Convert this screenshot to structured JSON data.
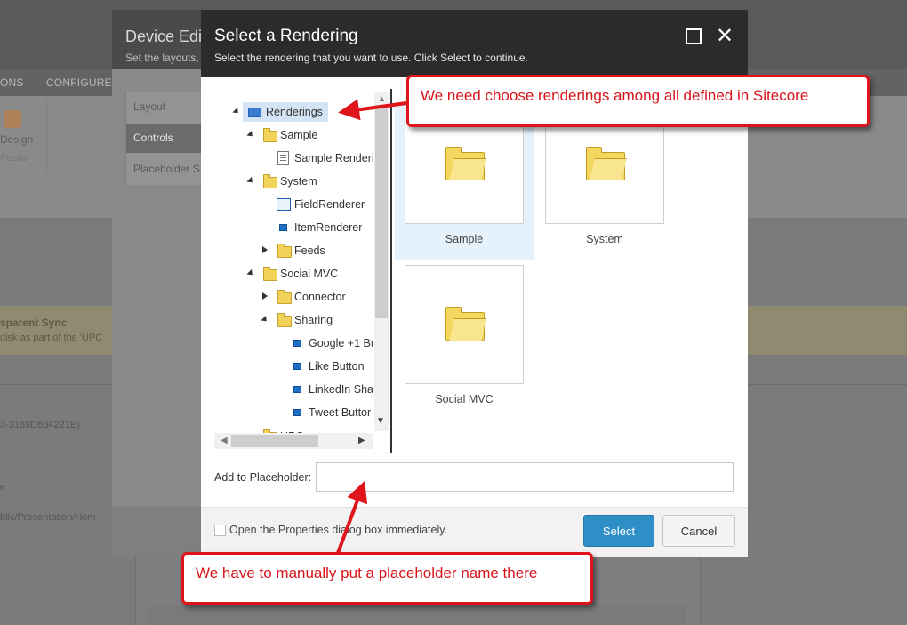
{
  "background": {
    "ribbon_tabs": [
      "ONS",
      "CONFIGURE"
    ],
    "ribbon_design_label": "Design",
    "ribbon_feeds_label": "Feeds",
    "warning_title": "sparent Sync",
    "warning_text": "disk as part of the 'UPC",
    "item_guid": "3-3189D684221E}",
    "field_e": "e",
    "item_path": "blic/Presentation/Hom"
  },
  "device_editor": {
    "title": "Device Edi",
    "subtitle": "Set the layouts,",
    "nav": [
      "Layout",
      "Controls",
      "Placeholder S"
    ],
    "selected_nav": "Controls"
  },
  "dialog": {
    "title": "Select a Rendering",
    "subtitle": "Select the rendering that you want to use. Click Select to continue.",
    "tree": [
      {
        "label": "Renderings",
        "icon": "renderings-root-icon",
        "expander": "down",
        "selected": true
      },
      {
        "label": "Sample",
        "icon": "folder-icon",
        "expander": "down"
      },
      {
        "label": "Sample Renderi",
        "icon": "rendering-document-icon",
        "expander": ""
      },
      {
        "label": "System",
        "icon": "folder-icon",
        "expander": "down"
      },
      {
        "label": "FieldRenderer",
        "icon": "field-renderer-icon",
        "expander": ""
      },
      {
        "label": "ItemRenderer",
        "icon": "rendering-icon",
        "expander": ""
      },
      {
        "label": "Feeds",
        "icon": "folder-icon",
        "expander": "right"
      },
      {
        "label": "Social MVC",
        "icon": "folder-icon",
        "expander": "down"
      },
      {
        "label": "Connector",
        "icon": "folder-icon",
        "expander": "right"
      },
      {
        "label": "Sharing",
        "icon": "folder-icon",
        "expander": "down"
      },
      {
        "label": "Google +1 Bu",
        "icon": "rendering-icon",
        "expander": ""
      },
      {
        "label": "Like Button",
        "icon": "rendering-icon",
        "expander": ""
      },
      {
        "label": "LinkedIn Sha",
        "icon": "rendering-icon",
        "expander": ""
      },
      {
        "label": "Tweet Buttor",
        "icon": "rendering-icon",
        "expander": ""
      },
      {
        "label": "UPC",
        "icon": "folder-icon",
        "expander": ""
      }
    ],
    "tiles": [
      {
        "label": "Sample",
        "icon": "large-folder-icon",
        "highlighted": true
      },
      {
        "label": "System",
        "icon": "large-folder-icon",
        "highlighted": false
      },
      {
        "label": "Social MVC",
        "icon": "large-folder-icon",
        "highlighted": false
      }
    ],
    "placeholder_label": "Add to Placeholder:",
    "placeholder_value": "",
    "open_properties_label": "Open the Properties dialog box immediately.",
    "open_properties_checked": false,
    "select_button": "Select",
    "cancel_button": "Cancel",
    "accent_color": "#2e8fc7"
  },
  "annotations": {
    "callout_top": "We need choose renderings among all defined in Sitecore",
    "callout_bottom": "We have to manually put a placeholder name there",
    "callout_color": "#e0141b"
  }
}
